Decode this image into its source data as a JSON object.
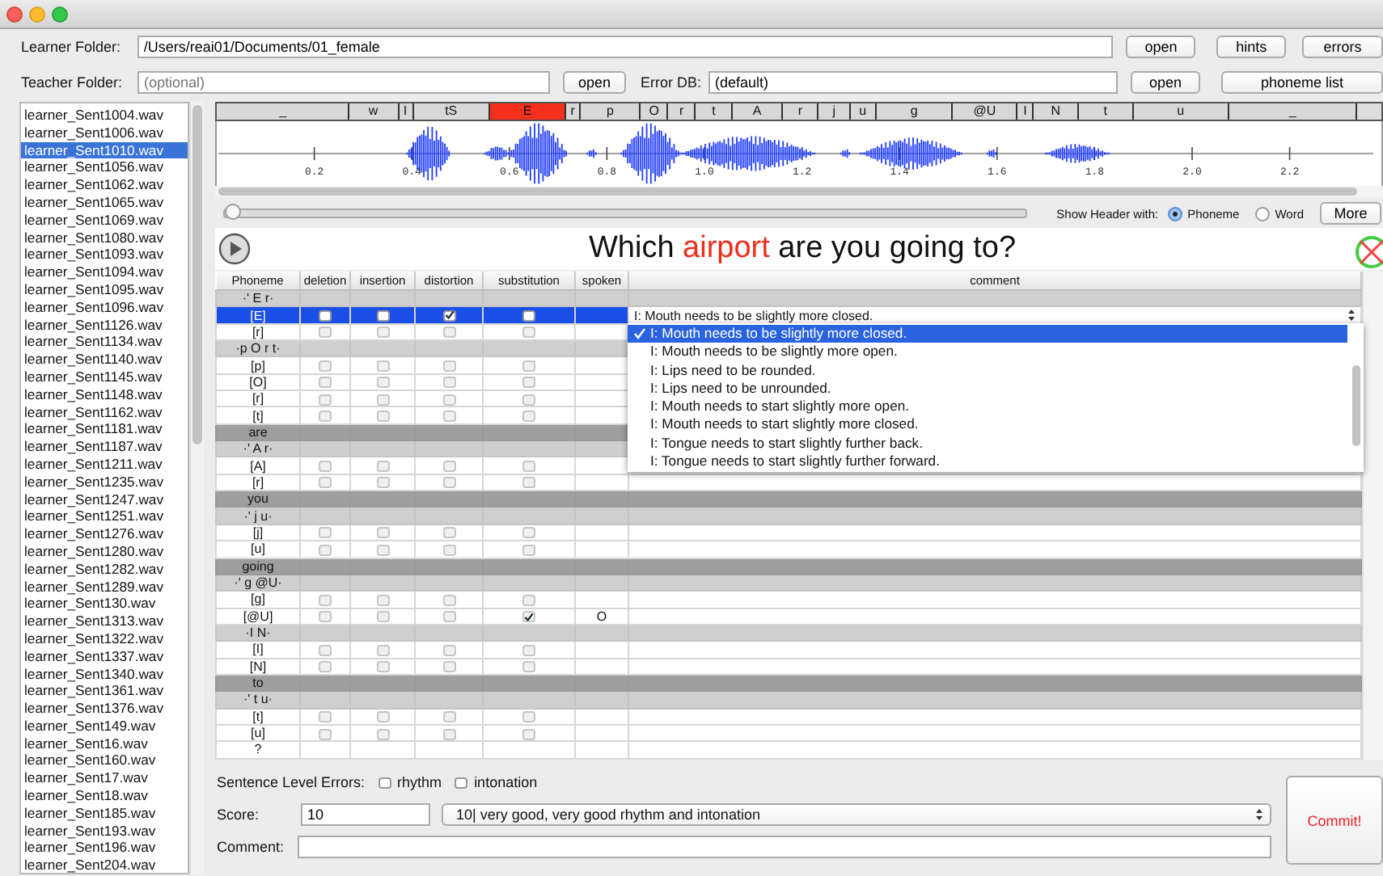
{
  "learner_folder": {
    "label": "Learner Folder:",
    "value": "/Users/reai01/Documents/01_female",
    "button": "open"
  },
  "teacher_folder": {
    "label": "Teacher Folder:",
    "placeholder": "(optional)",
    "button": "open"
  },
  "error_db": {
    "label": "Error DB:",
    "value": "(default)",
    "button": "open"
  },
  "tool_buttons": [
    "hints",
    "errors",
    "phoneme list"
  ],
  "files": [
    {
      "name": "learner_Sent1004.wav",
      "selected": false
    },
    {
      "name": "learner_Sent1006.wav",
      "selected": false
    },
    {
      "name": "learner_Sent1010.wav",
      "selected": true
    },
    {
      "name": "learner_Sent1056.wav",
      "selected": false
    },
    {
      "name": "learner_Sent1062.wav",
      "selected": false
    },
    {
      "name": "learner_Sent1065.wav",
      "selected": false
    },
    {
      "name": "learner_Sent1069.wav",
      "selected": false
    },
    {
      "name": "learner_Sent1080.wav",
      "selected": false
    },
    {
      "name": "learner_Sent1093.wav",
      "selected": false
    },
    {
      "name": "learner_Sent1094.wav",
      "selected": false
    },
    {
      "name": "learner_Sent1095.wav",
      "selected": false
    },
    {
      "name": "learner_Sent1096.wav",
      "selected": false
    },
    {
      "name": "learner_Sent1126.wav",
      "selected": false
    },
    {
      "name": "learner_Sent1134.wav",
      "selected": false
    },
    {
      "name": "learner_Sent1140.wav",
      "selected": false
    },
    {
      "name": "learner_Sent1145.wav",
      "selected": false
    },
    {
      "name": "learner_Sent1148.wav",
      "selected": false
    },
    {
      "name": "learner_Sent1162.wav",
      "selected": false
    },
    {
      "name": "learner_Sent1181.wav",
      "selected": false
    },
    {
      "name": "learner_Sent1187.wav",
      "selected": false
    },
    {
      "name": "learner_Sent1211.wav",
      "selected": false
    },
    {
      "name": "learner_Sent1235.wav",
      "selected": false
    },
    {
      "name": "learner_Sent1247.wav",
      "selected": false
    },
    {
      "name": "learner_Sent1251.wav",
      "selected": false
    },
    {
      "name": "learner_Sent1276.wav",
      "selected": false
    },
    {
      "name": "learner_Sent1280.wav",
      "selected": false
    },
    {
      "name": "learner_Sent1282.wav",
      "selected": false
    },
    {
      "name": "learner_Sent1289.wav",
      "selected": false
    },
    {
      "name": "learner_Sent130.wav",
      "selected": false
    },
    {
      "name": "learner_Sent1313.wav",
      "selected": false
    },
    {
      "name": "learner_Sent1322.wav",
      "selected": false
    },
    {
      "name": "learner_Sent1337.wav",
      "selected": false
    },
    {
      "name": "learner_Sent1340.wav",
      "selected": false
    },
    {
      "name": "learner_Sent1361.wav",
      "selected": false
    },
    {
      "name": "learner_Sent1376.wav",
      "selected": false
    },
    {
      "name": "learner_Sent149.wav",
      "selected": false
    },
    {
      "name": "learner_Sent16.wav",
      "selected": false
    },
    {
      "name": "learner_Sent160.wav",
      "selected": false
    },
    {
      "name": "learner_Sent17.wav",
      "selected": false
    },
    {
      "name": "learner_Sent18.wav",
      "selected": false
    },
    {
      "name": "learner_Sent185.wav",
      "selected": false
    },
    {
      "name": "learner_Sent193.wav",
      "selected": false
    },
    {
      "name": "learner_Sent196.wav",
      "selected": false
    },
    {
      "name": "learner_Sent204.wav",
      "selected": false
    }
  ],
  "phoneme_tier": [
    {
      "label": "_",
      "selected": false
    },
    {
      "label": "w",
      "selected": false
    },
    {
      "label": "I",
      "selected": false
    },
    {
      "label": "tS",
      "selected": false
    },
    {
      "label": "E",
      "selected": true
    },
    {
      "label": "r",
      "selected": false
    },
    {
      "label": "p",
      "selected": false
    },
    {
      "label": "O",
      "selected": false
    },
    {
      "label": "r",
      "selected": false
    },
    {
      "label": "t",
      "selected": false
    },
    {
      "label": "A",
      "selected": false
    },
    {
      "label": "r",
      "selected": false
    },
    {
      "label": "j",
      "selected": false
    },
    {
      "label": "u",
      "selected": false
    },
    {
      "label": "g",
      "selected": false
    },
    {
      "label": "@U",
      "selected": false
    },
    {
      "label": "I",
      "selected": false
    },
    {
      "label": "N",
      "selected": false
    },
    {
      "label": "t",
      "selected": false
    },
    {
      "label": "u",
      "selected": false
    },
    {
      "label": "_",
      "selected": false
    }
  ],
  "time_labels": [
    "0.2",
    "0.4",
    "0.6",
    "0.8",
    "1.0",
    "1.2",
    "1.4",
    "1.6",
    "1.8",
    "2.0",
    "2.2"
  ],
  "playback": {
    "level": 0
  },
  "header_options": {
    "label": "Show Header with:",
    "options": [
      {
        "label": "Phoneme",
        "selected": true
      },
      {
        "label": "Word",
        "selected": false
      }
    ]
  },
  "more_button": "More",
  "sentence": [
    {
      "text": "Which ",
      "highlight": false
    },
    {
      "text": "airport",
      "highlight": true
    },
    {
      "text": " are you going to?",
      "highlight": false
    }
  ],
  "table": {
    "columns": [
      "Phoneme",
      "deletion",
      "insertion",
      "distortion",
      "substitution",
      "spoken",
      "comment"
    ],
    "rows": [
      {
        "kind": "syllable",
        "label": "·' E r·"
      },
      {
        "kind": "phoneme",
        "label": "[E]",
        "selected": true,
        "deletion": false,
        "insertion": false,
        "distortion": true,
        "substitution": false,
        "comment": "I: Mouth needs to be slightly more closed."
      },
      {
        "kind": "phoneme",
        "label": "[r]",
        "selected": false,
        "deletion": false,
        "insertion": false,
        "distortion": false,
        "substitution": false
      },
      {
        "kind": "syllable",
        "label": "·p O r t·"
      },
      {
        "kind": "phoneme",
        "label": "[p]",
        "selected": false,
        "deletion": false,
        "insertion": false,
        "distortion": false,
        "substitution": false
      },
      {
        "kind": "phoneme",
        "label": "[O]",
        "selected": false,
        "deletion": false,
        "insertion": false,
        "distortion": false,
        "substitution": false
      },
      {
        "kind": "phoneme",
        "label": "[r]",
        "selected": false,
        "deletion": false,
        "insertion": false,
        "distortion": false,
        "substitution": false
      },
      {
        "kind": "phoneme",
        "label": "[t]",
        "selected": false,
        "deletion": false,
        "insertion": false,
        "distortion": false,
        "substitution": false
      },
      {
        "kind": "word",
        "label": "are"
      },
      {
        "kind": "syllable",
        "label": "·' A r·"
      },
      {
        "kind": "phoneme",
        "label": "[A]",
        "selected": false,
        "deletion": false,
        "insertion": false,
        "distortion": false,
        "substitution": false
      },
      {
        "kind": "phoneme",
        "label": "[r]",
        "selected": false,
        "deletion": false,
        "insertion": false,
        "distortion": false,
        "substitution": false
      },
      {
        "kind": "word",
        "label": "you"
      },
      {
        "kind": "syllable",
        "label": "·' j u·"
      },
      {
        "kind": "phoneme",
        "label": "[j]",
        "selected": false,
        "deletion": false,
        "insertion": false,
        "distortion": false,
        "substitution": false
      },
      {
        "kind": "phoneme",
        "label": "[u]",
        "selected": false,
        "deletion": false,
        "insertion": false,
        "distortion": false,
        "substitution": false
      },
      {
        "kind": "word",
        "label": "going"
      },
      {
        "kind": "syllable",
        "label": "·' g @U·"
      },
      {
        "kind": "phoneme",
        "label": "[g]",
        "selected": false,
        "deletion": false,
        "insertion": false,
        "distortion": false,
        "substitution": false
      },
      {
        "kind": "phoneme",
        "label": "[@U]",
        "selected": false,
        "deletion": false,
        "insertion": false,
        "distortion": false,
        "substitution": true,
        "spoken": "O"
      },
      {
        "kind": "syllable",
        "label": "·I N·"
      },
      {
        "kind": "phoneme",
        "label": "[I]",
        "selected": false,
        "deletion": false,
        "insertion": false,
        "distortion": false,
        "substitution": false
      },
      {
        "kind": "phoneme",
        "label": "[N]",
        "selected": false,
        "deletion": false,
        "insertion": false,
        "distortion": false,
        "substitution": false
      },
      {
        "kind": "word",
        "label": "to"
      },
      {
        "kind": "syllable",
        "label": "·' t u·"
      },
      {
        "kind": "phoneme",
        "label": "[t]",
        "selected": false,
        "deletion": false,
        "insertion": false,
        "distortion": false,
        "substitution": false
      },
      {
        "kind": "phoneme",
        "label": "[u]",
        "selected": false,
        "deletion": false,
        "insertion": false,
        "distortion": false,
        "substitution": false
      },
      {
        "kind": "punct",
        "label": "?"
      }
    ]
  },
  "comment_menu": [
    {
      "label": "I: Mouth needs to be slightly more closed.",
      "selected": true
    },
    {
      "label": "I: Mouth needs to be slightly more open.",
      "selected": false
    },
    {
      "label": "I: Lips need to be rounded.",
      "selected": false
    },
    {
      "label": "I: Lips need to be unrounded.",
      "selected": false
    },
    {
      "label": "I: Mouth needs to start slightly more open.",
      "selected": false
    },
    {
      "label": "I: Mouth needs to start slightly more closed.",
      "selected": false
    },
    {
      "label": "I: Tongue needs to start slightly further back.",
      "selected": false
    },
    {
      "label": "I: Tongue needs to start slightly further forward.",
      "selected": false
    }
  ],
  "sentence_errors": {
    "label": "Sentence Level Errors:",
    "options": [
      {
        "label": "rhythm",
        "checked": false
      },
      {
        "label": "intonation",
        "checked": false
      }
    ]
  },
  "score": {
    "label": "Score:",
    "value": "10",
    "choice": "10| very good, very good rhythm and intonation"
  },
  "comment": {
    "label": "Comment:"
  },
  "commit_button": "Commit!"
}
